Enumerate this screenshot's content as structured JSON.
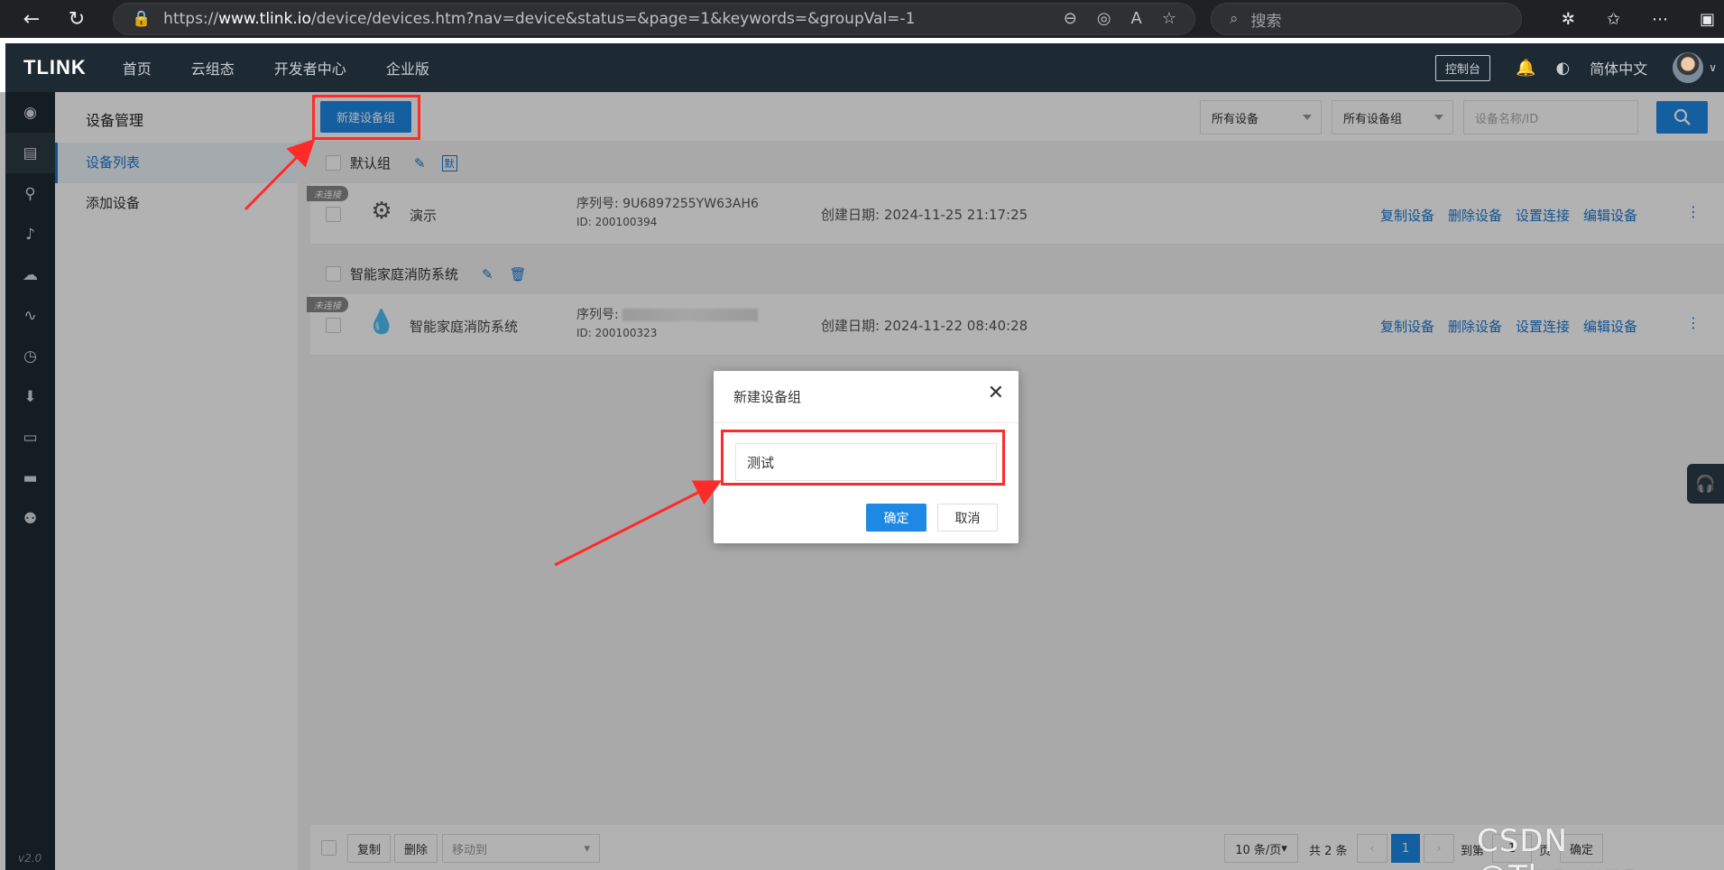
{
  "browser": {
    "url_prefix": "https://",
    "url_host": "www.tlink.io",
    "url_path": "/device/devices.htm?nav=device&status=&page=1&keywords=&groupVal=-1",
    "search_placeholder": "搜索"
  },
  "header": {
    "logo": "TLINK",
    "nav": [
      "首页",
      "云组态",
      "开发者中心",
      "企业版"
    ],
    "console": "控制台",
    "language": "简体中文"
  },
  "sidebar": {
    "version": "v2.0",
    "title": "设备管理",
    "items": [
      {
        "label": "设备列表",
        "active": true
      },
      {
        "label": "添加设备",
        "active": false
      }
    ]
  },
  "toolbar": {
    "new_group": "新建设备组",
    "filter_devices": "所有设备",
    "filter_groups": "所有设备组",
    "search_placeholder": "设备名称/ID"
  },
  "groups": [
    {
      "name": "默认组",
      "devices": [
        {
          "status": "未连接",
          "name": "演示",
          "serial_label": "序列号:",
          "serial": "9U6897255YW63AH6",
          "id_label": "ID:",
          "id": "200100394",
          "date_label": "创建日期:",
          "date": "2024-11-25 21:17:25"
        }
      ]
    },
    {
      "name": "智能家庭消防系统",
      "devices": [
        {
          "status": "未连接",
          "name": "智能家庭消防系统",
          "serial_label": "序列号:",
          "serial": "",
          "id_label": "ID:",
          "id": "200100323",
          "date_label": "创建日期:",
          "date": "2024-11-22 08:40:28"
        }
      ]
    }
  ],
  "actions": {
    "copy": "复制设备",
    "delete": "删除设备",
    "connect": "设置连接",
    "edit": "编辑设备"
  },
  "pager": {
    "copy": "复制",
    "delete": "删除",
    "move_to": "移动到",
    "page_size": "10 条/页",
    "total": "共 2 条",
    "current_page": "1",
    "goto_prefix": "到第",
    "goto_value": "1",
    "goto_suffix": "页",
    "confirm": "确定"
  },
  "modal": {
    "title": "新建设备组",
    "input_value": "测试",
    "ok": "确定",
    "cancel": "取消"
  },
  "watermark": "CSDN @The_xzs",
  "colors": {
    "accent": "#1e88e5",
    "highlight": "#ff2a2a",
    "header": "#1e2a33"
  }
}
